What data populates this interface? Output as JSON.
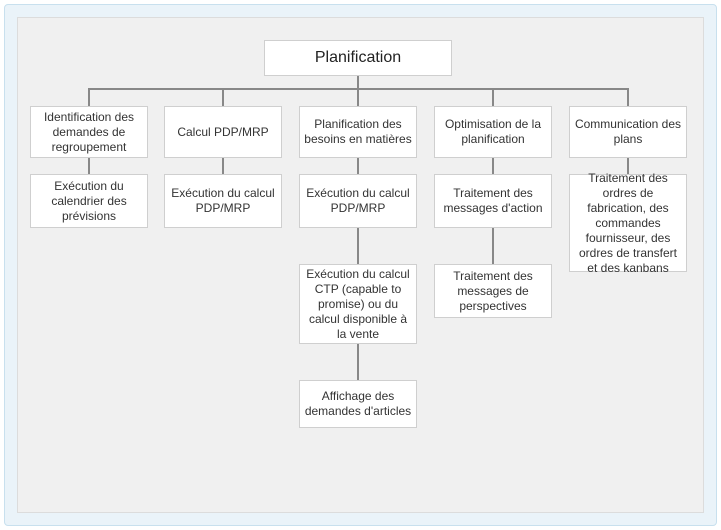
{
  "root": {
    "label": "Planification"
  },
  "cols": [
    {
      "head": "Identification des demandes de regroupement",
      "items": [
        "Exécution du calendrier des prévisions"
      ]
    },
    {
      "head": "Calcul PDP/MRP",
      "items": [
        "Exécution du calcul PDP/MRP"
      ]
    },
    {
      "head": "Planification des besoins en matières",
      "items": [
        "Exécution du calcul PDP/MRP",
        "Exécution du calcul CTP (capable to promise) ou du calcul disponible à la vente",
        "Affichage des demandes d'articles"
      ]
    },
    {
      "head": "Optimisation de la planification",
      "items": [
        "Traitement des messages d'action",
        "Traitement des messages de perspectives"
      ]
    },
    {
      "head": "Communication des plans",
      "items": [
        "Traitement des ordres de fabrication, des commandes fournisseur, des ordres de transfert et des kanbans"
      ]
    }
  ]
}
